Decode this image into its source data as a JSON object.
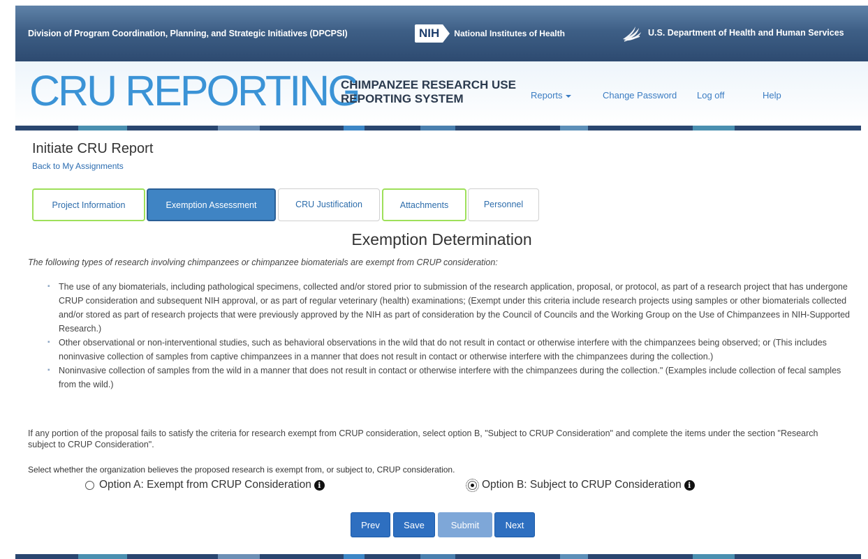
{
  "top_bar": {
    "division_text": "Division of Program Coordination, Planning, and Strategic Initiatives (DPCPSI)",
    "nih_badge": "NIH",
    "nih_text": "National Institutes of Health",
    "hhs_text": "U.S. Department of Health and Human Services"
  },
  "header": {
    "logo_text": "CRU REPORTING",
    "subtitle_line1": "CHIMPANZEE RESEARCH USE",
    "subtitle_line2": "REPORTING SYSTEM",
    "nav": {
      "reports": "Reports",
      "change_password": "Change Password",
      "log_off": "Log off",
      "help": "Help"
    }
  },
  "page": {
    "title": "Initiate CRU Report",
    "back_link": "Back to My Assignments"
  },
  "tabs": [
    {
      "label": "Project Information",
      "state": "complete"
    },
    {
      "label": "Exemption Assessment",
      "state": "active"
    },
    {
      "label": "CRU Justification",
      "state": "default"
    },
    {
      "label": "Attachments",
      "state": "complete"
    },
    {
      "label": "Personnel",
      "state": "default"
    }
  ],
  "section": {
    "title": "Exemption Determination",
    "intro": "The following types of research involving chimpanzees or chimpanzee biomaterials are exempt from CRUP consideration:",
    "bullets": [
      "The use of any biomaterials, including pathological specimens, collected and/or stored prior to submission of the research application, proposal, or protocol, as part of a research project that has undergone CRUP consideration and subsequent NIH approval, or as part of regular veterinary (health) examinations; (Exempt under this criteria include research projects using samples or other biomaterials collected and/or stored as part of research projects that were previously approved by the NIH as part of consideration by the Council of Councils and the Working Group on the Use of Chimpanzees in NIH-Supported Research.)",
      "Other observational or non-interventional studies, such as behavioral observations in the wild that do not result in contact or otherwise interfere with the chimpanzees being observed; or (This includes noninvasive collection of samples from captive chimpanzees in a manner that does not result in contact or otherwise interfere with the chimpanzees during the collection.)",
      "Noninvasive collection of samples from the wild in a manner that does not result in contact or otherwise interfere with the chimpanzees during the collection.\" (Examples include collection of fecal samples from the wild.)"
    ],
    "note": "If any portion of the proposal fails to satisfy the criteria for research exempt from CRUP consideration, select option B, \"Subject to CRUP Consideration\" and complete the items under the section \"Research subject to CRUP Consideration\".",
    "select_question": "Select whether the organization believes the proposed research is exempt from, or subject to, CRUP consideration.",
    "option_a": "Option A: Exempt from CRUP Consideration",
    "option_b": "Option B: Subject to CRUP Consideration",
    "selected_option": "B"
  },
  "buttons": {
    "prev": "Prev",
    "save": "Save",
    "submit": "Submit",
    "next": "Next"
  },
  "colors": {
    "top_bar": "#3e5f86",
    "logo": "#3b93d6",
    "active_tab": "#3f84c4",
    "complete_tab_border": "#9ee05a",
    "button": "#2e6fc0",
    "button_disabled": "#7ea7d8"
  },
  "icons": {
    "info": "info-circle-icon",
    "hhs": "hhs-eagle-logo"
  }
}
